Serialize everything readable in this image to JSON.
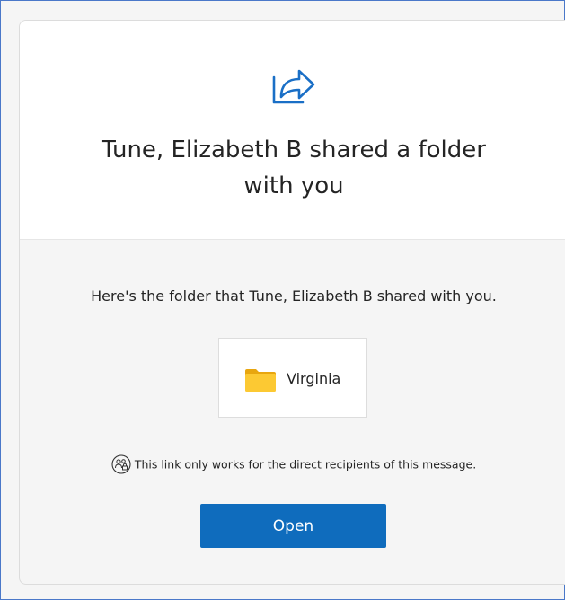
{
  "header": {
    "title_line1": "Tune, Elizabeth B shared a folder",
    "title_line2": "with you",
    "icon": "share-arrow-icon"
  },
  "body": {
    "message": "Here's the folder that Tune, Elizabeth B shared with you.",
    "folder": {
      "name": "Virginia",
      "icon": "folder-icon"
    },
    "notice": {
      "icon": "people-lock-icon",
      "text": "This link only works for the direct recipients of this message."
    },
    "open_label": "Open"
  },
  "colors": {
    "accent": "#0f6cbd",
    "frame_border": "#4a78c9",
    "folder_yellow": "#f8c21d",
    "text": "#242424"
  }
}
